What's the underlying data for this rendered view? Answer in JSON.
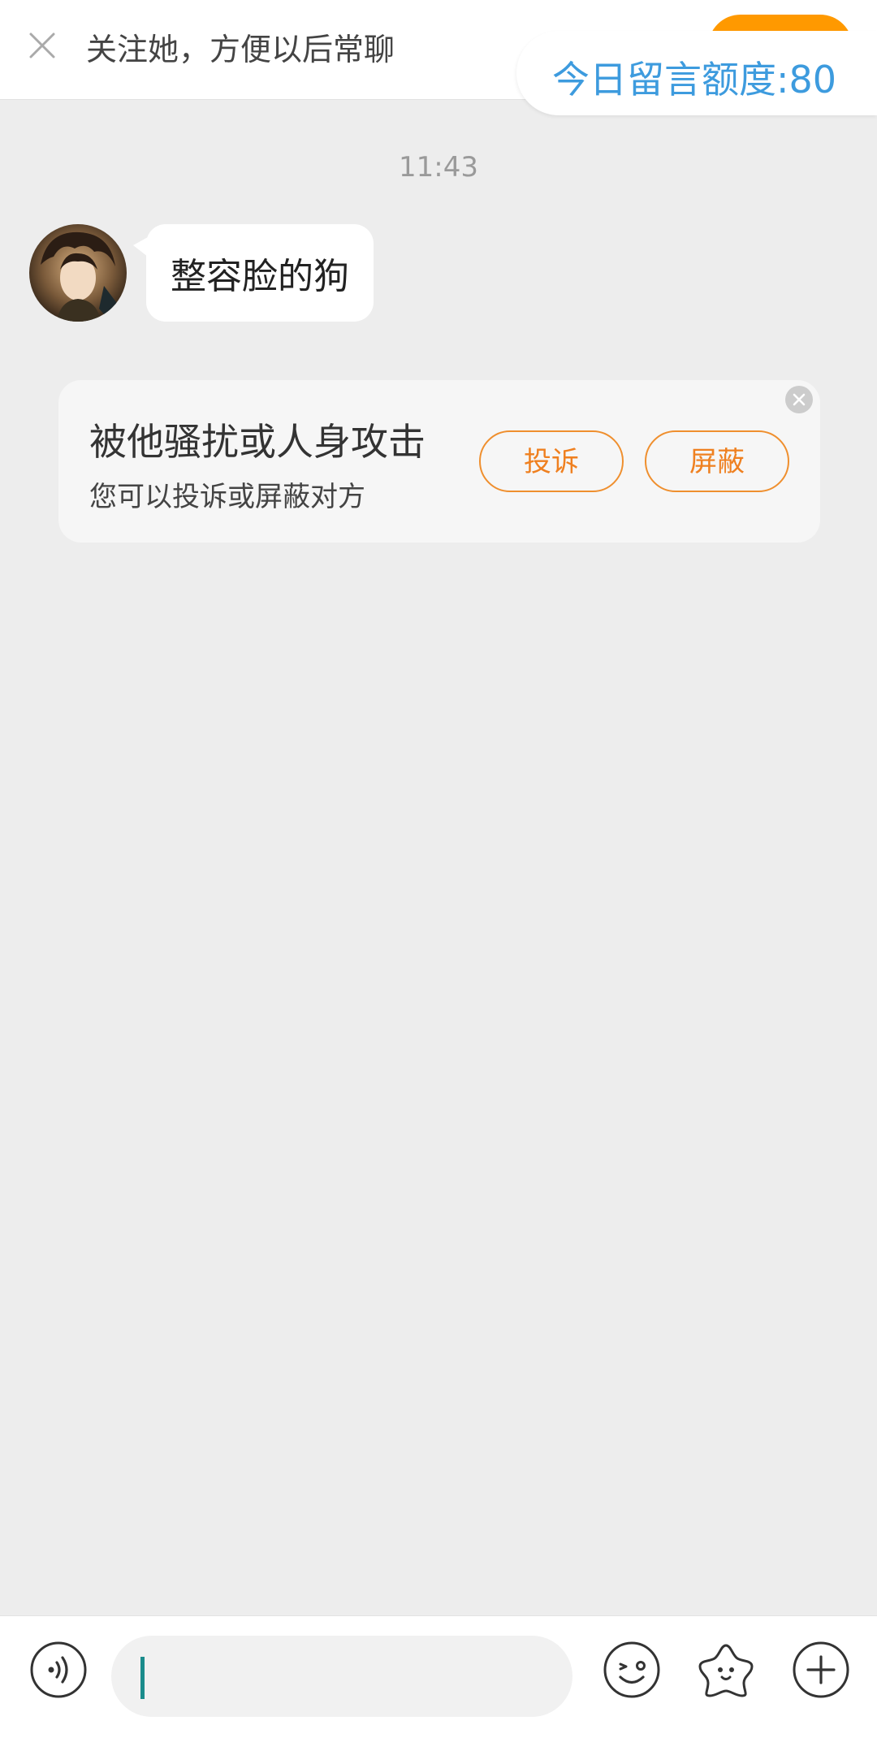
{
  "header": {
    "follow_prompt": "关注她，方便以后常聊",
    "quota_label": "今日留言额度:80"
  },
  "chat": {
    "timestamp": "11:43",
    "messages": [
      {
        "sender": "other",
        "text": "整容脸的狗"
      }
    ]
  },
  "report_card": {
    "title": "被他骚扰或人身攻击",
    "subtitle": "您可以投诉或屏蔽对方",
    "report_button": "投诉",
    "block_button": "屏蔽"
  },
  "input_bar": {
    "value": "",
    "icons": [
      "voice-icon",
      "emoji-icon",
      "sticker-icon",
      "plus-icon"
    ]
  },
  "colors": {
    "accent_blue": "#3d9bde",
    "accent_orange": "#ef8f2e",
    "background": "#ededed"
  }
}
